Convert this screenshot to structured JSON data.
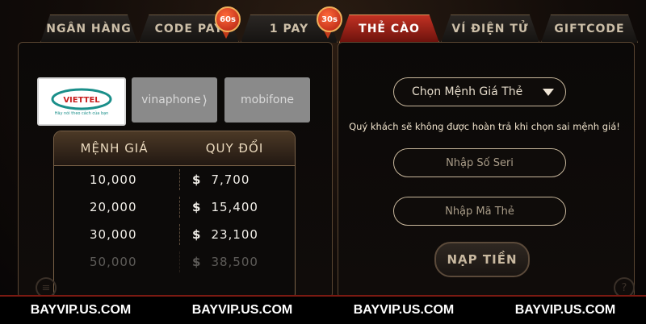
{
  "tabs": [
    {
      "label": "NGÂN HÀNG"
    },
    {
      "label": "CODE PAY",
      "badge": "60s"
    },
    {
      "label": "1 PAY",
      "badge": "30s"
    },
    {
      "label": "THẺ CÀO",
      "active": true
    },
    {
      "label": "VÍ ĐIỆN TỬ"
    },
    {
      "label": "GIFTCODE"
    }
  ],
  "carriers": {
    "viettel": {
      "name": "VIETTEL",
      "tagline": "Hãy nói theo cách của bạn"
    },
    "vinaphone": {
      "name": "vinaphone"
    },
    "mobifone": {
      "name": "mobifone"
    }
  },
  "rate_table": {
    "headers": [
      "MỆNH GIÁ",
      "QUY ĐỔI"
    ],
    "currency": "$",
    "rows": [
      {
        "value": "10,000",
        "exchange": "7,700"
      },
      {
        "value": "20,000",
        "exchange": "15,400"
      },
      {
        "value": "30,000",
        "exchange": "23,100"
      },
      {
        "value": "50,000",
        "exchange": "38,500"
      }
    ]
  },
  "form": {
    "denomination_label": "Chọn Mệnh Giá Thẻ",
    "warning": "Quý khách sẽ không được hoàn trả khi chọn sai mệnh giá!",
    "serial_placeholder": "Nhập Số Seri",
    "pin_placeholder": "Nhập Mã Thẻ",
    "submit_label": "NẠP TIỀN"
  },
  "footer": {
    "items": [
      "BAYVIP.US.COM",
      "BAYVIP.US.COM",
      "BAYVIP.US.COM",
      "BAYVIP.US.COM"
    ]
  },
  "colors": {
    "accent_red": "#c23123",
    "gold_border": "#e39a5e",
    "background": "#0b0807"
  }
}
